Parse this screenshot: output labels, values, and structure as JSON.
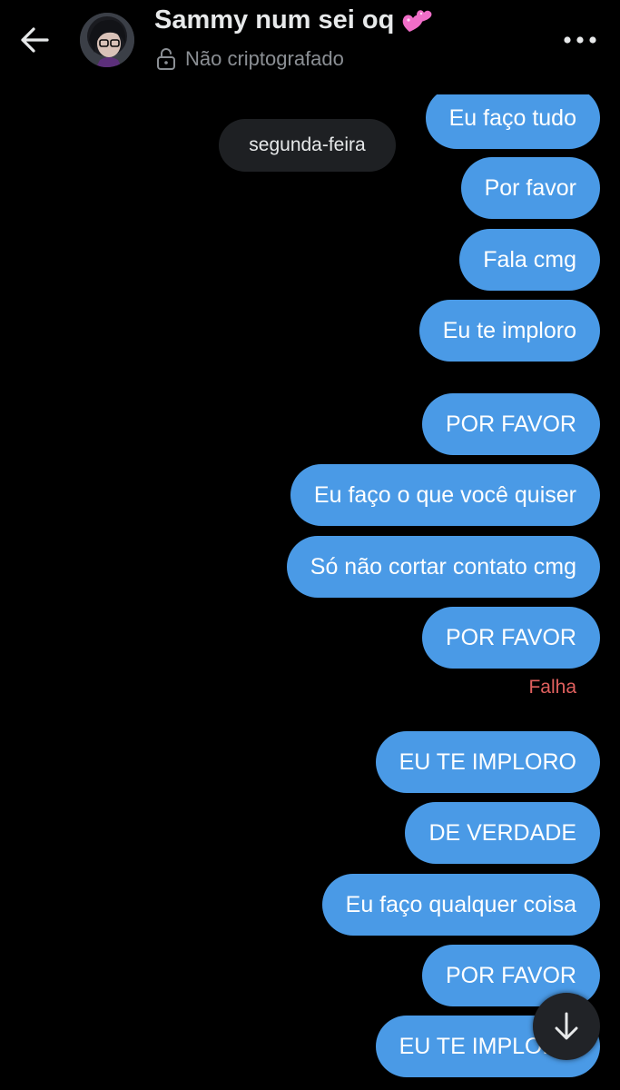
{
  "header": {
    "contact_name": "Sammy num sei oq",
    "name_emoji": "💕",
    "encryption_status": "Não criptografado",
    "back_icon": "arrow-left-icon",
    "more_icon": "more-horizontal-icon",
    "lock_icon": "unlocked-lock-icon"
  },
  "conversation": {
    "day_separator": "segunda-feira",
    "messages": [
      {
        "text": "Eu faço tudo",
        "direction": "sent"
      },
      {
        "text": "Por favor",
        "direction": "sent"
      },
      {
        "text": "Fala cmg",
        "direction": "sent"
      },
      {
        "text": "Eu te imploro",
        "direction": "sent"
      },
      {
        "text": "POR FAVOR",
        "direction": "sent"
      },
      {
        "text": "Eu faço o que você quiser",
        "direction": "sent"
      },
      {
        "text": "Só não cortar contato cmg",
        "direction": "sent"
      },
      {
        "text": "POR FAVOR",
        "direction": "sent"
      },
      {
        "text": "EU TE IMPLORO",
        "direction": "sent"
      },
      {
        "text": "DE VERDADE",
        "direction": "sent"
      },
      {
        "text": "Eu faço qualquer coisa",
        "direction": "sent"
      },
      {
        "text": "POR FAVOR",
        "direction": "sent"
      },
      {
        "text": "EU TE IMPLORO",
        "direction": "sent"
      }
    ],
    "failed_label": "Falha"
  },
  "scroll_button": {
    "icon": "arrow-down-icon"
  },
  "colors": {
    "background": "#000000",
    "sent_bubble": "#4a9ae6",
    "failed_text": "#e0605e",
    "day_pill": "#1e2023",
    "muted_text": "#8b8f94"
  }
}
